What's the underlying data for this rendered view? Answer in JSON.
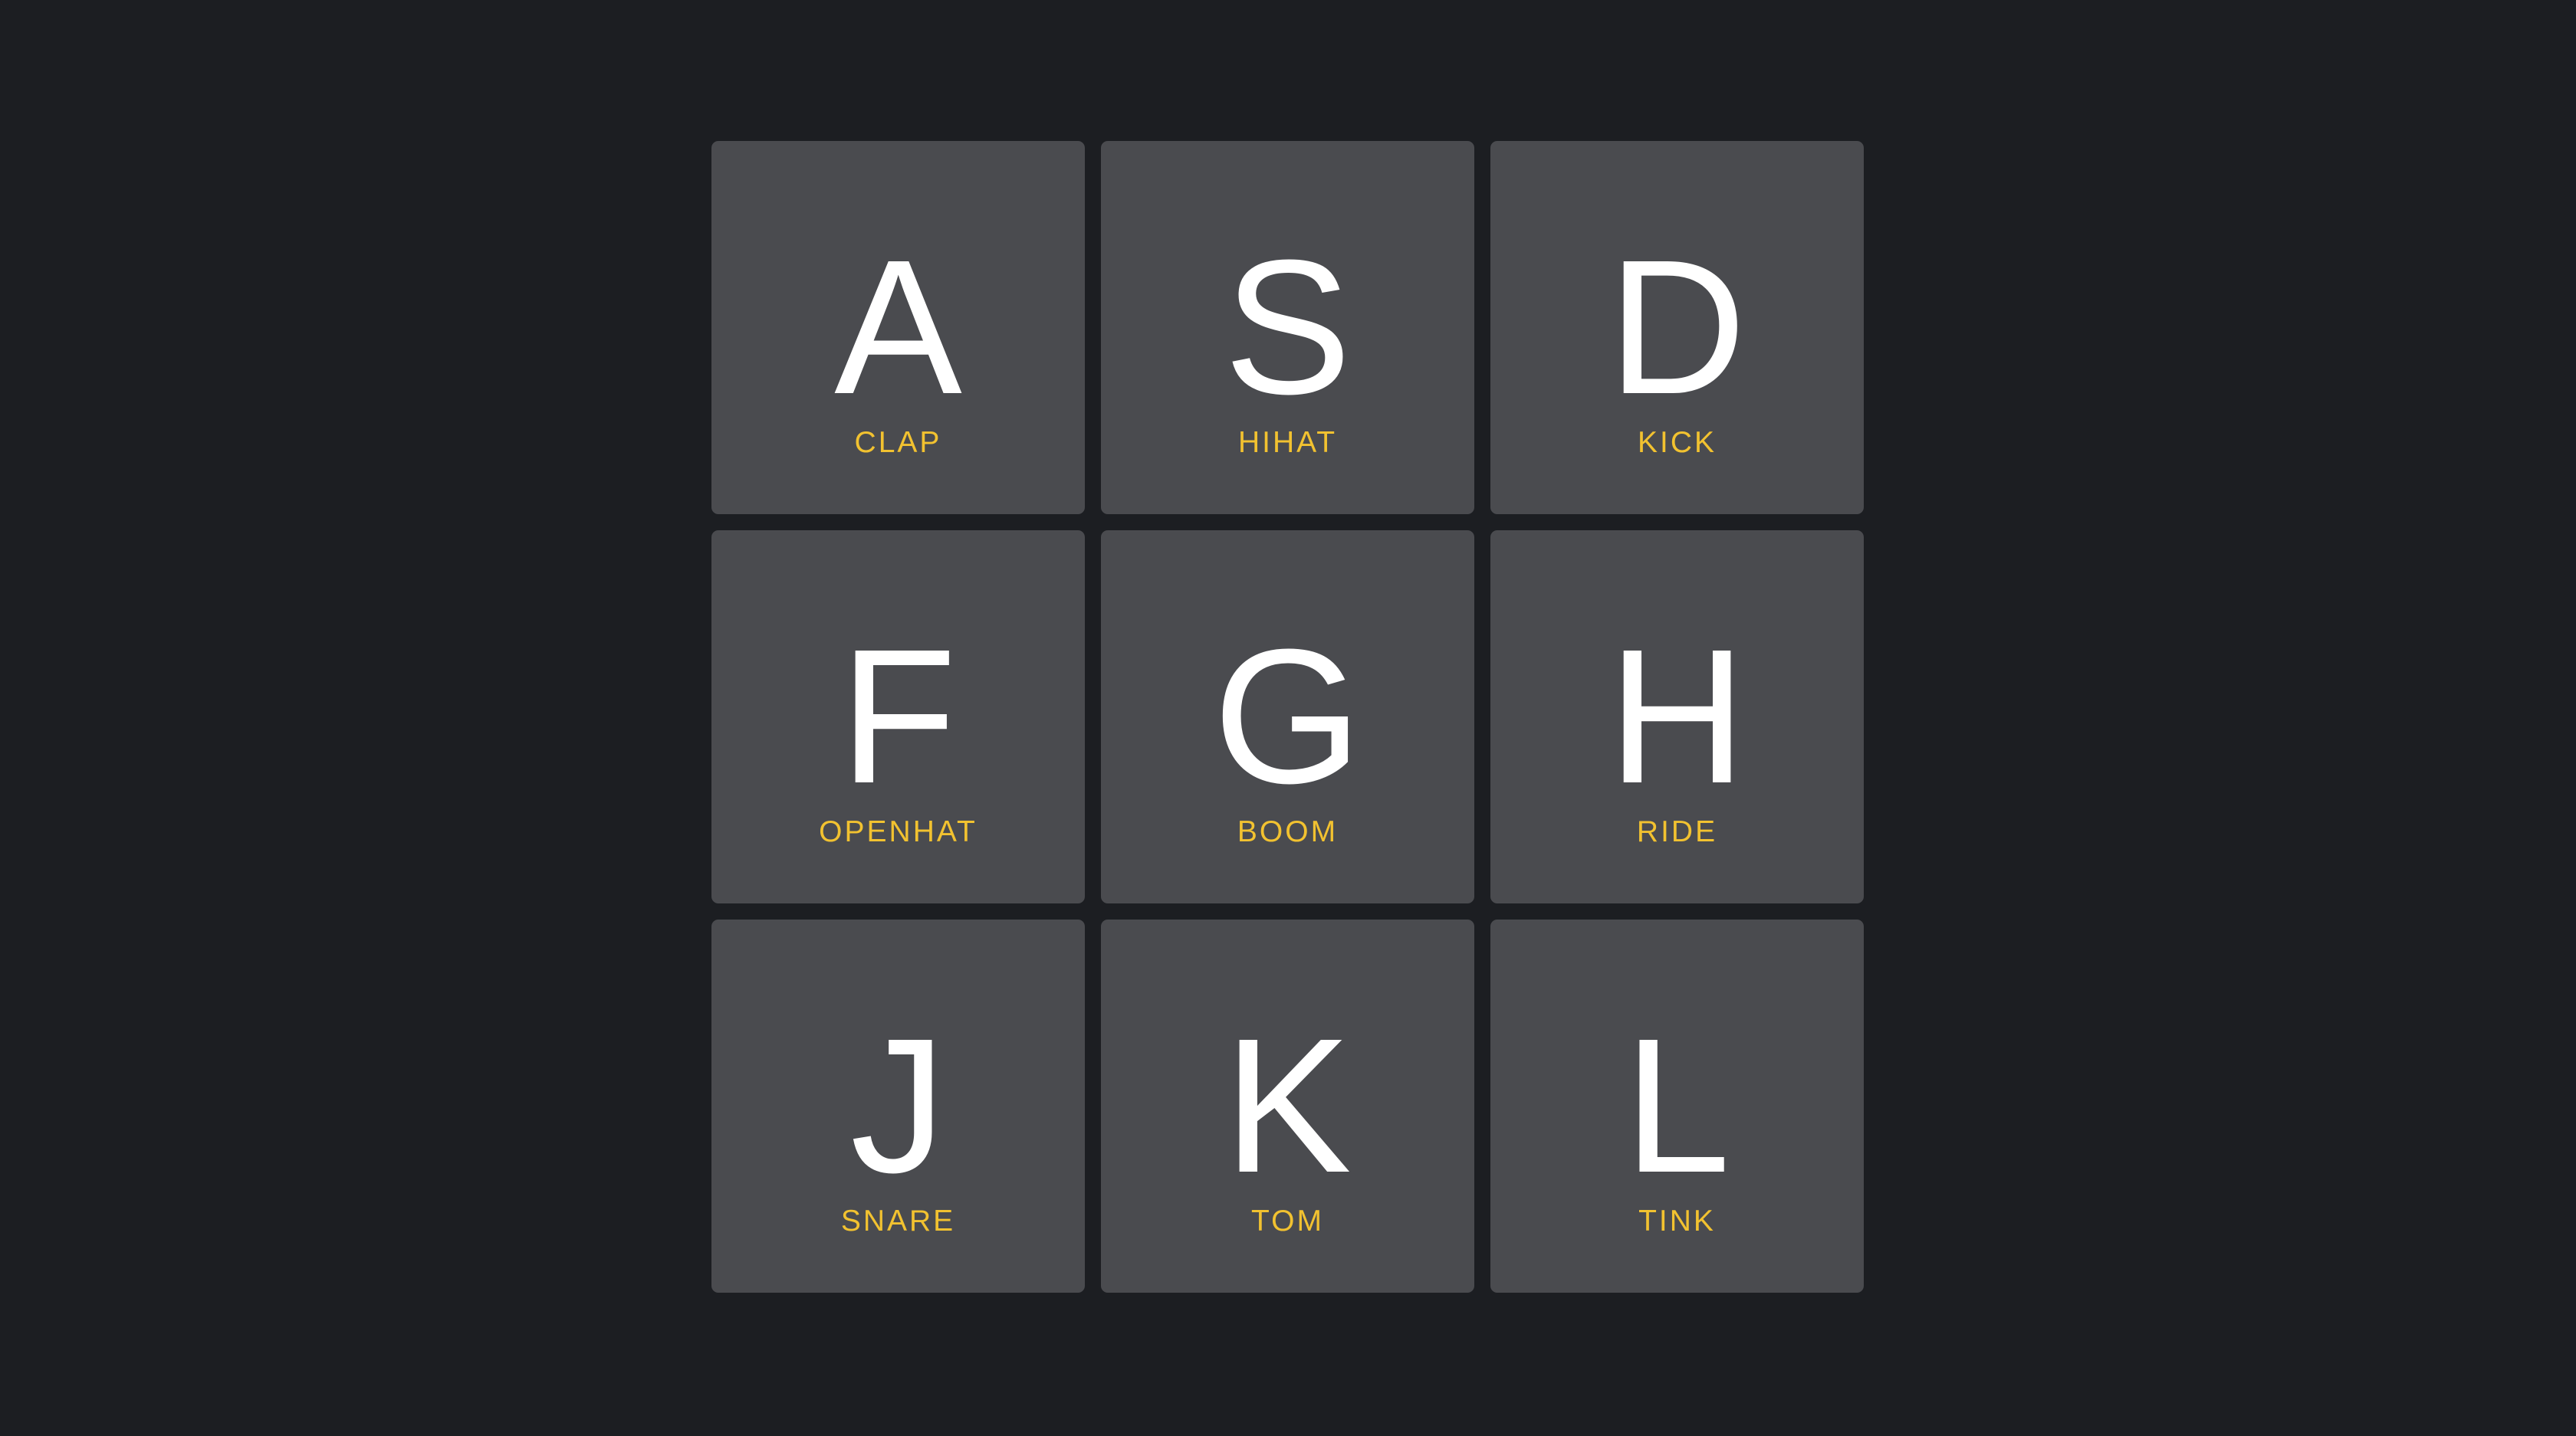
{
  "colors": {
    "background": "#1c1e22",
    "pad": "#4a4b4f",
    "key_text": "#ffffff",
    "sound_text": "#f2c230"
  },
  "pads": [
    {
      "key": "A",
      "sound": "CLAP"
    },
    {
      "key": "S",
      "sound": "HIHAT"
    },
    {
      "key": "D",
      "sound": "KICK"
    },
    {
      "key": "F",
      "sound": "OPENHAT"
    },
    {
      "key": "G",
      "sound": "BOOM"
    },
    {
      "key": "H",
      "sound": "RIDE"
    },
    {
      "key": "J",
      "sound": "SNARE"
    },
    {
      "key": "K",
      "sound": "TOM"
    },
    {
      "key": "L",
      "sound": "TINK"
    }
  ]
}
